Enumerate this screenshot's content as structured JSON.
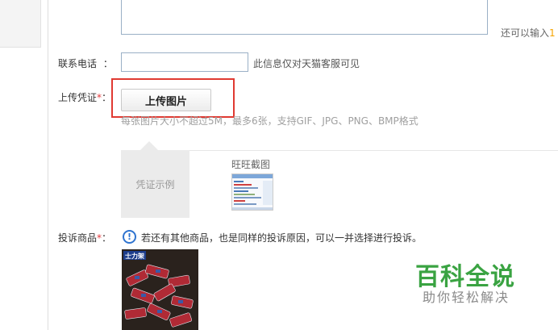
{
  "reason_field": {
    "hint_prefix": "还可以输入",
    "hint_count": "1"
  },
  "phone": {
    "label": "联系电话",
    "colon": "：",
    "value": "",
    "hint": "此信息仅对天猫客服可见"
  },
  "upload": {
    "label": "上传凭证",
    "required_mark": "*",
    "colon": "：",
    "button_label": "上传图片",
    "hint": "每张图片大小不超过5M，最多6张，支持GIF、JPG、PNG、BMP格式"
  },
  "sample": {
    "tab_label": "凭证示例",
    "title": "旺旺截图"
  },
  "product": {
    "label": "投诉商品",
    "required_mark": "*",
    "colon": "：",
    "tip": "若还有其他商品，也是同样的投诉原因，可以一并选择进行投诉。",
    "thumb_brand": "士力架"
  },
  "watermark": {
    "title": "百科全说",
    "subtitle": "助你轻松解决"
  },
  "colors": {
    "required": "#e4393c",
    "highlight_box": "#e03a32",
    "info": "#2f74d0",
    "watermark": "#3aa342"
  }
}
